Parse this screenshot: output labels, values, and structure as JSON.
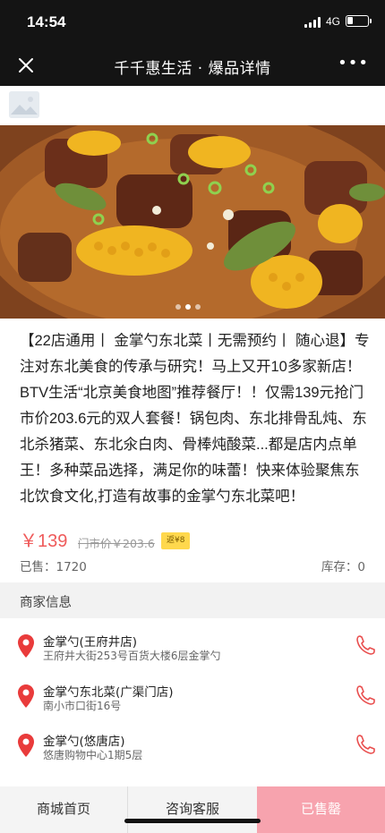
{
  "status_bar": {
    "time": "14:54",
    "network": "4G"
  },
  "nav": {
    "title": "千千惠生活 · 爆品详情",
    "more": "•••"
  },
  "product": {
    "description": "【22店通用丨 金掌勺东北菜丨无需预约丨 随心退】专注对东北美食的传承与研究！马上又开10多家新店！BTV生活“北京美食地图”推荐餐厅！！仅需139元抢门市价203.6元的双人套餐！锅包肉、东北排骨乱炖、东北杀猪菜、东北氽白肉、骨棒炖酸菜...都是店内点单王！多种菜品选择，满足你的味蕾！快来体验聚焦东北饮食文化,打造有故事的金掌勺东北菜吧！",
    "price": "￥139",
    "original_price": "门市价￥203.6",
    "rebate": "返¥8",
    "sold": "已售：1720",
    "stock": "库存：0"
  },
  "merchant_section": {
    "title": "商家信息"
  },
  "stores": [
    {
      "name": "金掌勺(王府井店)",
      "address": "王府井大街253号百货大楼6层金掌勺"
    },
    {
      "name": "金掌勺东北菜(广渠门店)",
      "address": "南小市口街16号"
    },
    {
      "name": "金掌勺(悠唐店)",
      "address": "悠唐购物中心1期5层"
    }
  ],
  "bottom_bar": {
    "home": "商城首页",
    "service": "咨询客服",
    "sold_out": "已售罄"
  },
  "colors": {
    "accent": "#ef5b5b",
    "sold_out_bg": "#f7a3ae",
    "header_bg": "#141414",
    "rebate_bg": "#ffd84d"
  },
  "icons": [
    "close-icon",
    "more-icon",
    "location-pin-icon",
    "phone-icon",
    "signal-icon",
    "battery-icon"
  ]
}
